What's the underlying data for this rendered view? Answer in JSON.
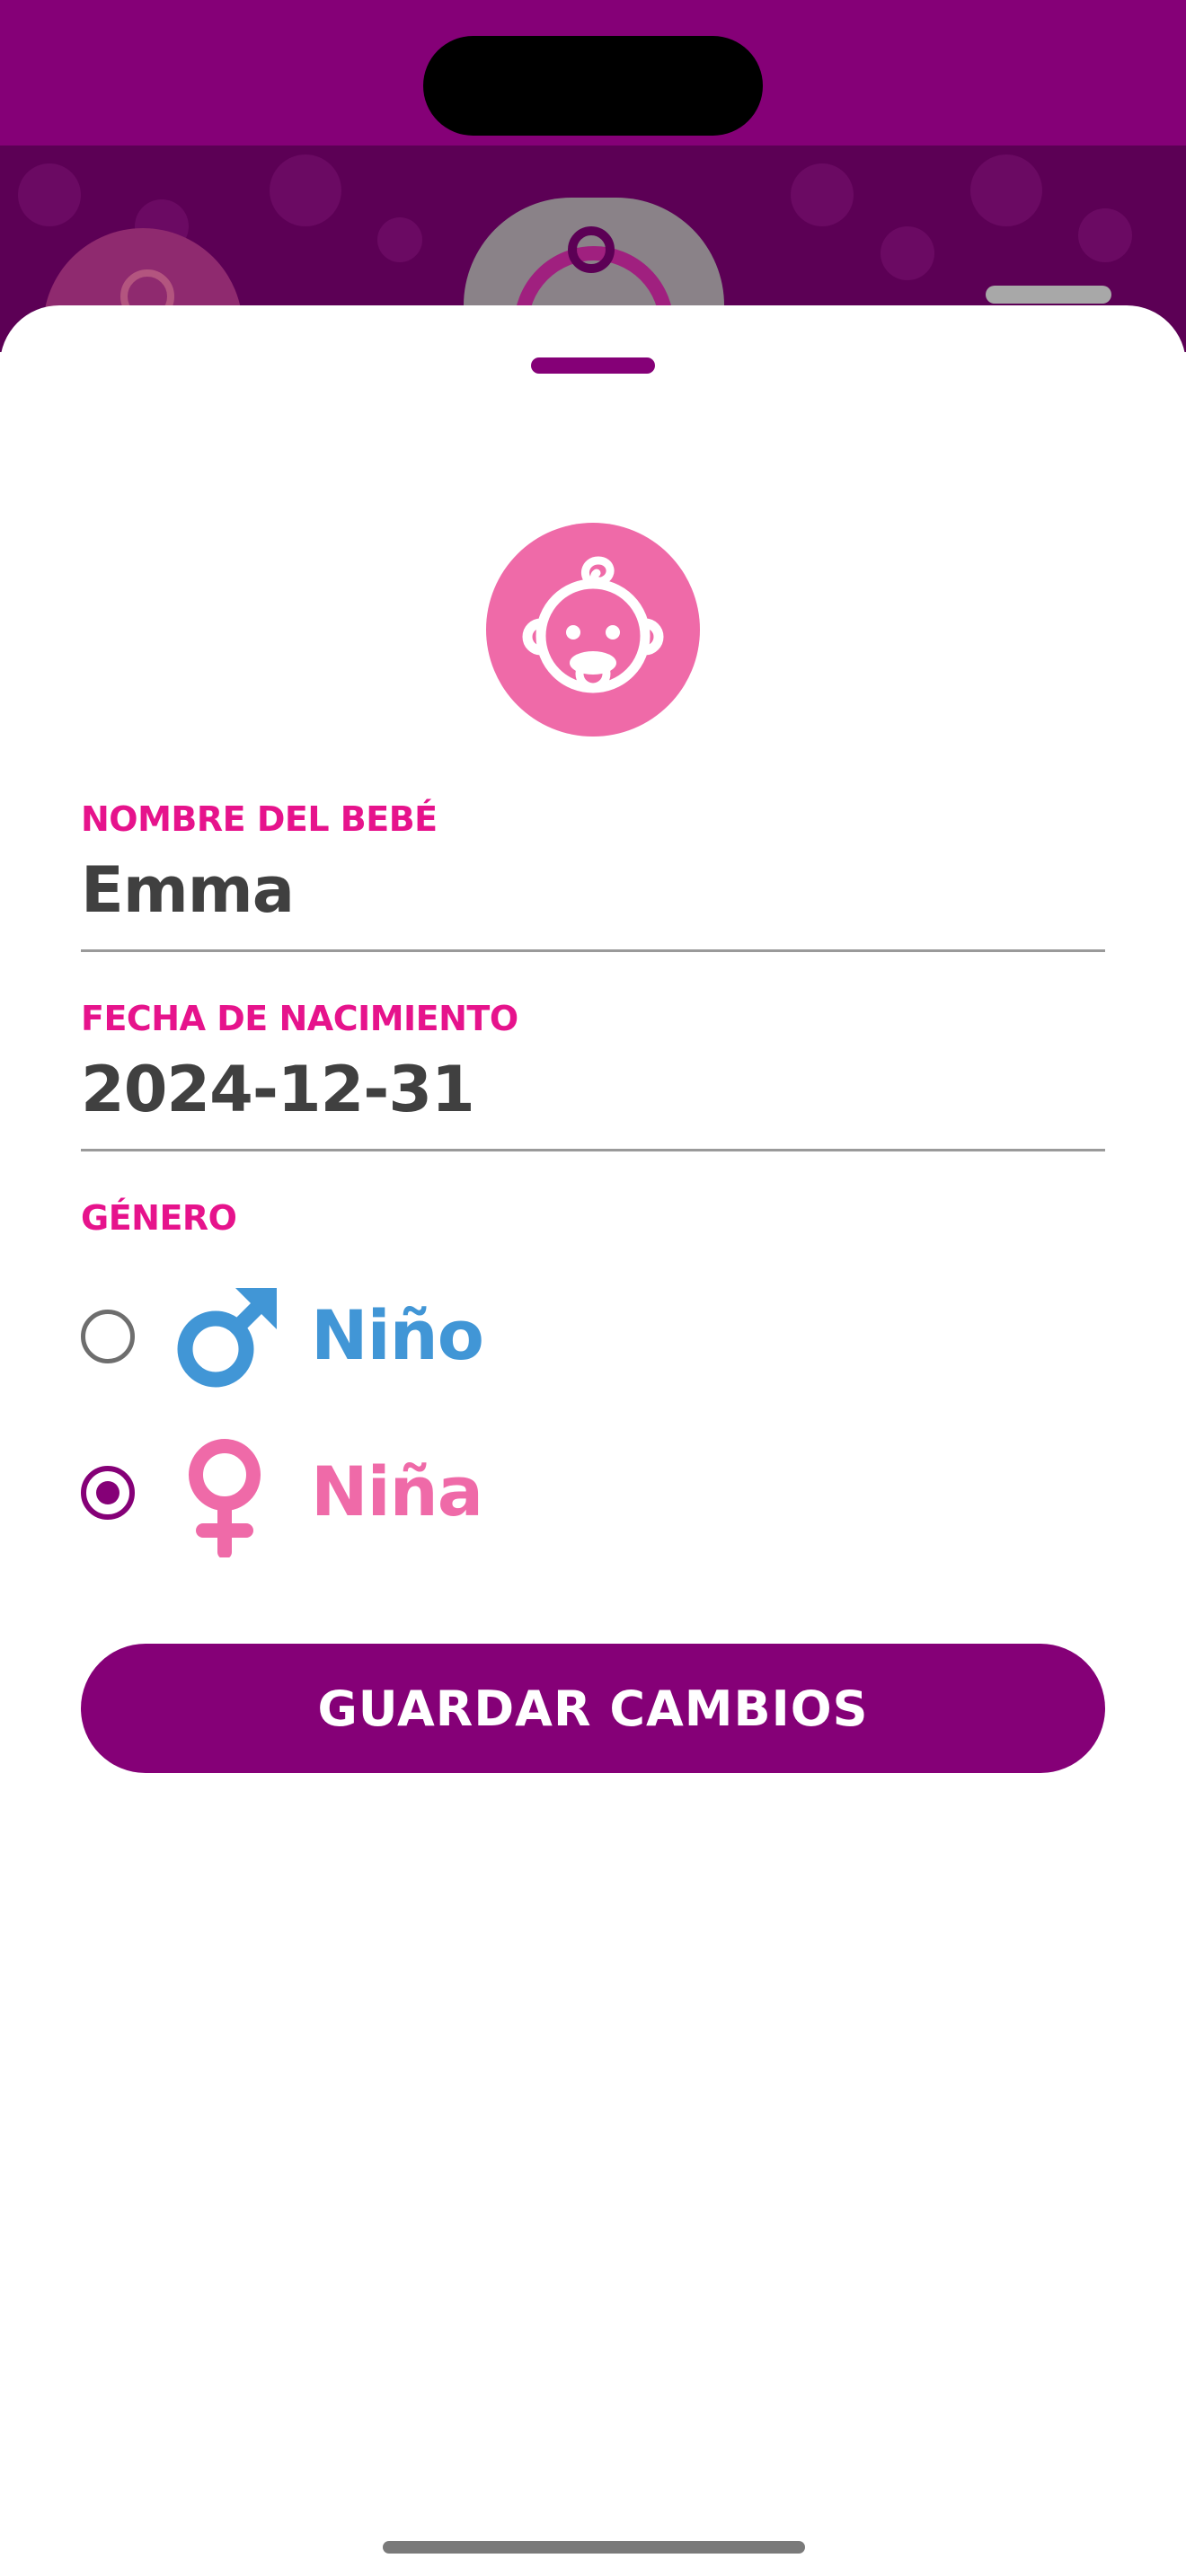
{
  "colors": {
    "brand_purple": "#850077",
    "label_pink": "#e6138c",
    "avatar_pink": "#ef6aa8",
    "boy_blue": "#4196d6",
    "girl_pink": "#ef6aa8",
    "value_gray": "#404040"
  },
  "avatar": {
    "icon": "baby-face-icon"
  },
  "form": {
    "name_label": "NOMBRE DEL BEBÉ",
    "name_value": "Emma",
    "birthdate_label": "FECHA DE NACIMIENTO",
    "birthdate_value": "2024-12-31",
    "gender_label": "GÉNERO",
    "gender_options": [
      {
        "label": "Niño",
        "icon": "male-symbol-icon",
        "selected": false
      },
      {
        "label": "Niña",
        "icon": "female-symbol-icon",
        "selected": true
      }
    ]
  },
  "actions": {
    "save_label": "GUARDAR CAMBIOS"
  }
}
